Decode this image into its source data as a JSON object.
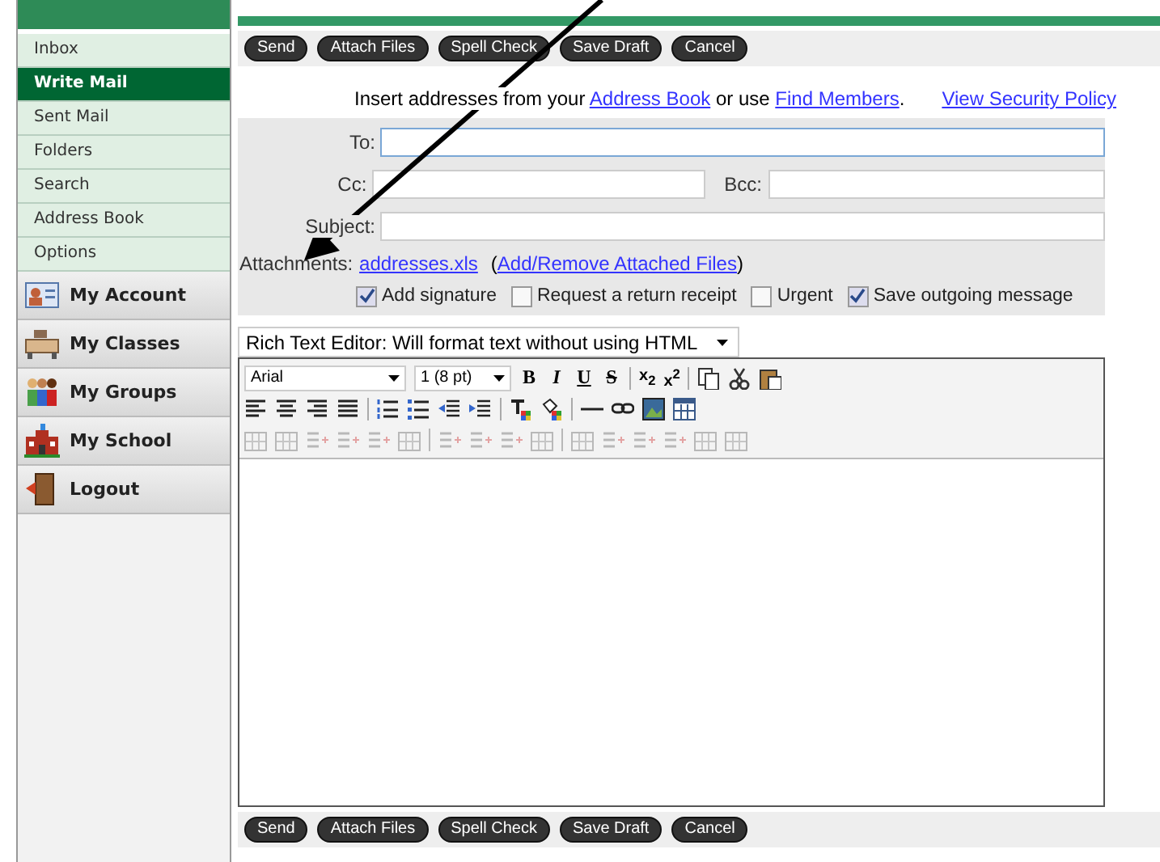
{
  "sidebar": {
    "mail_items": [
      {
        "label": "Inbox",
        "selected": false
      },
      {
        "label": "Write Mail",
        "selected": true
      },
      {
        "label": "Sent Mail",
        "selected": false
      },
      {
        "label": "Folders",
        "selected": false
      },
      {
        "label": "Search",
        "selected": false
      },
      {
        "label": "Address Book",
        "selected": false
      },
      {
        "label": "Options",
        "selected": false
      }
    ],
    "sections": [
      {
        "label": "My Account",
        "kind": "account"
      },
      {
        "label": "My Classes",
        "kind": "classes"
      },
      {
        "label": "My Groups",
        "kind": "groups"
      },
      {
        "label": "My School",
        "kind": "school"
      },
      {
        "label": "Logout",
        "kind": "logout"
      }
    ]
  },
  "top_buttons": [
    "Send",
    "Attach Files",
    "Spell Check",
    "Save Draft",
    "Cancel"
  ],
  "address_hint": {
    "before": "Insert addresses from your",
    "link1": "Address Book",
    "middle": "or use",
    "link2": "Find Members",
    "after": ".",
    "policy_link": "View Security Policy"
  },
  "form": {
    "to_label": "To:",
    "cc_label": "Cc:",
    "bcc_label": "Bcc:",
    "subject_label": "Subject:",
    "attachments_label": "Attachments:",
    "attachment_file": "addresses.xls",
    "attachment_link": "Add/Remove Attached Files",
    "attachment_open": "(",
    "attachment_close": ")",
    "options": [
      {
        "label": "Add signature",
        "checked": true
      },
      {
        "label": "Request a return receipt",
        "checked": false
      },
      {
        "label": "Urgent",
        "checked": false
      },
      {
        "label": "Save outgoing message",
        "checked": true
      }
    ]
  },
  "editor": {
    "mode": "Rich Text Editor: Will format text without using HTML",
    "font": "Arial",
    "size": "1 (8 pt)",
    "format_buttons": [
      {
        "label": "B",
        "kind": "bold"
      },
      {
        "label": "I",
        "kind": "italic"
      },
      {
        "label": "U",
        "kind": "underline"
      },
      {
        "label": "S",
        "kind": "strike"
      }
    ],
    "script_buttons": [
      "x$_{2}$",
      "x$^{2}$"
    ]
  },
  "bottom_buttons": [
    "Send",
    "Attach Files",
    "Spell Check",
    "Save Draft",
    "Cancel"
  ]
}
